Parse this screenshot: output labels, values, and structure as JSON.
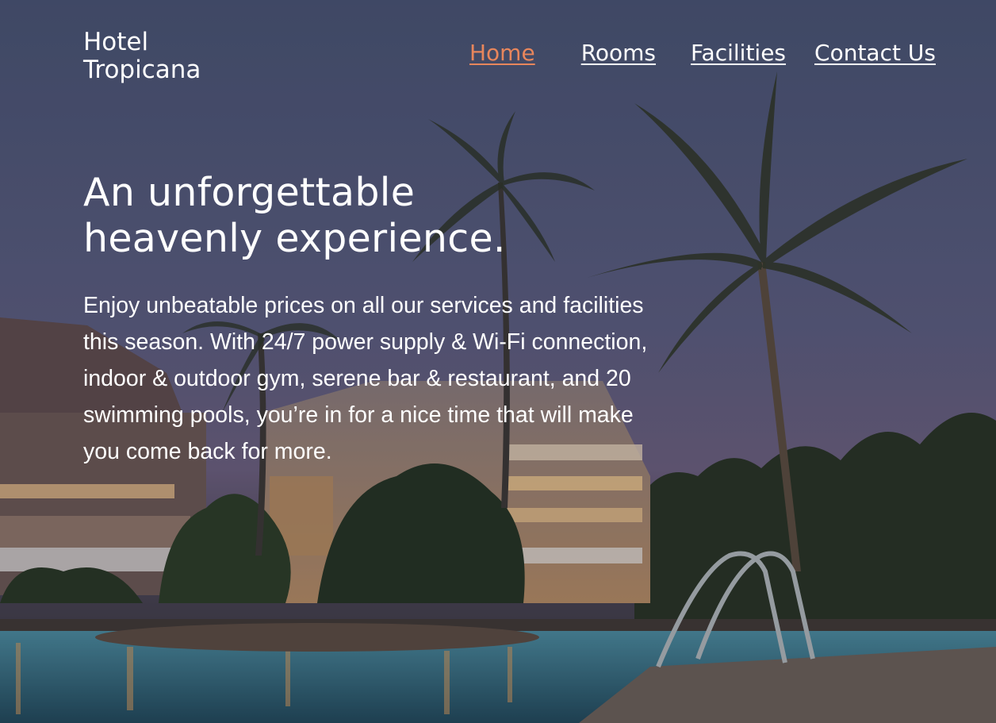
{
  "brand": {
    "line1": "Hotel",
    "line2": "Tropicana"
  },
  "nav": {
    "items": [
      {
        "label": "Home",
        "active": true
      },
      {
        "label": "Rooms",
        "active": false
      },
      {
        "label": "Facilities",
        "active": false
      },
      {
        "label": "Contact Us",
        "active": false
      }
    ],
    "active_color": "#e8865c"
  },
  "hero": {
    "headline_line1": "An unforgettable",
    "headline_line2": "heavenly experience.",
    "description": "Enjoy unbeatable prices on all our services and facilities this season. With 24/7 power supply & Wi-Fi connection, indoor & outdoor gym, serene bar & restaurant, and 20 swimming pools, you’re in for a nice time that will make you come back for more.",
    "background_image": "hotel-pool-palm-trees-dusk"
  }
}
